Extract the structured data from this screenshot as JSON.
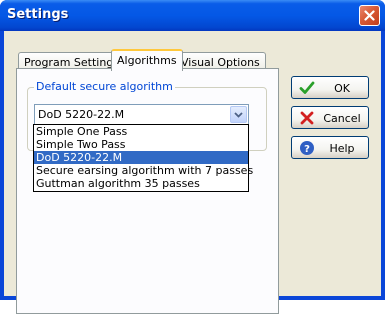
{
  "window": {
    "title": "Settings"
  },
  "tabs": [
    {
      "label": "Program Settings"
    },
    {
      "label": "Algorithms"
    },
    {
      "label": "Visual Options"
    }
  ],
  "algorithms": {
    "group_label": "Default secure algorithm",
    "selected": "DoD 5220-22.M",
    "options": [
      "Simple One Pass",
      "Simple Two Pass",
      "DoD 5220-22.M",
      "Secure earsing algorithm with 7 passes",
      "Guttman algorithm 35 passes"
    ]
  },
  "buttons": {
    "ok": "OK",
    "cancel": "Cancel",
    "help": "Help"
  },
  "icons": {
    "close": "close-icon",
    "ok": "checkmark-icon",
    "cancel": "x-icon",
    "help": "help-icon",
    "dropdown": "chevron-down-icon"
  },
  "colors": {
    "titlebar": "#0458e6",
    "selection": "#316ac5",
    "group_label": "#0046d5",
    "ok_icon": "#2aa02a",
    "cancel_icon": "#d32020",
    "help_icon": "#2f5fc4"
  }
}
